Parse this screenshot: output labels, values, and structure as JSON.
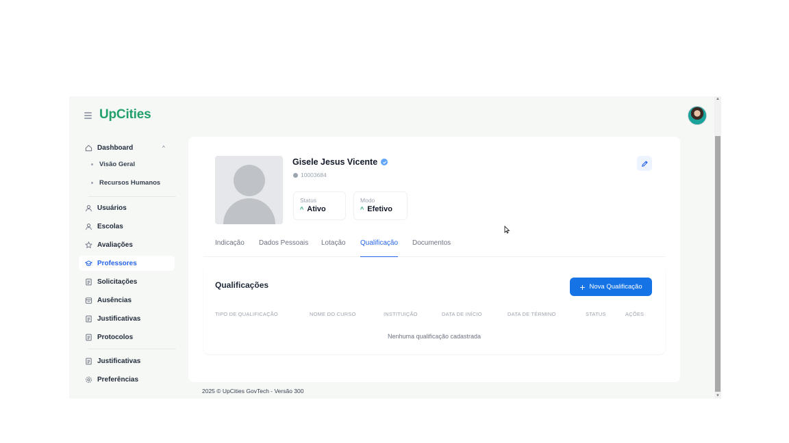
{
  "header": {
    "logo": "UpCities"
  },
  "sidebar": {
    "dashboard": "Dashboard",
    "sub_items": [
      "Visão Geral",
      "Recursos Humanos"
    ],
    "items": [
      "Usuários",
      "Escolas",
      "Avaliações",
      "Professores",
      "Solicitações",
      "Ausências",
      "Justificativas",
      "Protocolos"
    ],
    "bottom_items": [
      "Justificativas",
      "Preferências"
    ],
    "active": "Professores"
  },
  "profile": {
    "name": "Gisele Jesus Vicente",
    "id": "10003684",
    "status_label": "Status",
    "status_value": "Ativo",
    "mode_label": "Modo",
    "mode_value": "Efetivo"
  },
  "tabs": [
    "Indicação",
    "Dados Pessoais",
    "Lotação",
    "Qualificação",
    "Documentos"
  ],
  "active_tab": "Qualificação",
  "qualifications": {
    "title": "Qualificações",
    "new_button": "Nova Qualificação",
    "columns": [
      "TIPO DE QUALIFICAÇÃO",
      "NOME DO CURSO",
      "INSTITUIÇÃO",
      "DATA DE INÍCIO",
      "DATA DE TÉRMINO",
      "STATUS",
      "AÇÕES"
    ],
    "empty_message": "Nenhuma qualificação cadastrada"
  },
  "footer": {
    "text": "2025 © UpCities GovTech - Versão 300"
  },
  "colors": {
    "brand": "#22a06b",
    "accent": "#2563eb",
    "button": "#1673e6"
  }
}
